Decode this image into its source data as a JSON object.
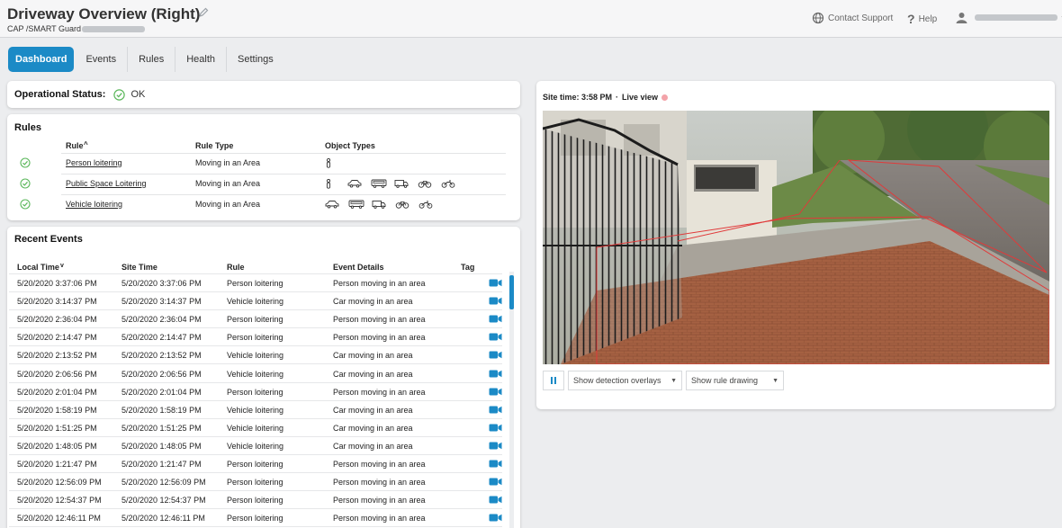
{
  "header": {
    "title": "Driveway Overview (Right)",
    "subtitle": "CAP /SMART Guard",
    "contact_support": "Contact Support",
    "help": "Help"
  },
  "tabs": [
    {
      "label": "Dashboard",
      "active": true
    },
    {
      "label": "Events",
      "active": false
    },
    {
      "label": "Rules",
      "active": false
    },
    {
      "label": "Health",
      "active": false
    },
    {
      "label": "Settings",
      "active": false
    }
  ],
  "operational_status": {
    "label": "Operational Status:",
    "value": "OK"
  },
  "rules": {
    "title": "Rules",
    "columns": {
      "rule": "Rule",
      "rule_type": "Rule Type",
      "object_types": "Object Types"
    },
    "rows": [
      {
        "name": "Person loitering",
        "type": "Moving in an Area",
        "objects": [
          "person-icon"
        ]
      },
      {
        "name": "Public Space Loitering",
        "type": "Moving in an Area",
        "objects": [
          "person-icon",
          "car-icon",
          "bus-icon",
          "truck-icon",
          "bicycle-icon",
          "motorcycle-icon"
        ]
      },
      {
        "name": "Vehicle loitering",
        "type": "Moving in an Area",
        "objects": [
          "car-icon",
          "bus-icon",
          "truck-icon",
          "bicycle-icon",
          "motorcycle-icon"
        ]
      }
    ]
  },
  "recent_events": {
    "title": "Recent Events",
    "columns": {
      "local_time": "Local Time",
      "site_time": "Site Time",
      "rule": "Rule",
      "event_details": "Event Details",
      "tag": "Tag"
    },
    "rows": [
      [
        "5/20/2020 3:37:06 PM",
        "5/20/2020 3:37:06 PM",
        "Person loitering",
        "Person moving in an area"
      ],
      [
        "5/20/2020 3:14:37 PM",
        "5/20/2020 3:14:37 PM",
        "Vehicle loitering",
        "Car moving in an area"
      ],
      [
        "5/20/2020 2:36:04 PM",
        "5/20/2020 2:36:04 PM",
        "Person loitering",
        "Person moving in an area"
      ],
      [
        "5/20/2020 2:14:47 PM",
        "5/20/2020 2:14:47 PM",
        "Person loitering",
        "Person moving in an area"
      ],
      [
        "5/20/2020 2:13:52 PM",
        "5/20/2020 2:13:52 PM",
        "Vehicle loitering",
        "Car moving in an area"
      ],
      [
        "5/20/2020 2:06:56 PM",
        "5/20/2020 2:06:56 PM",
        "Vehicle loitering",
        "Car moving in an area"
      ],
      [
        "5/20/2020 2:01:04 PM",
        "5/20/2020 2:01:04 PM",
        "Person loitering",
        "Person moving in an area"
      ],
      [
        "5/20/2020 1:58:19 PM",
        "5/20/2020 1:58:19 PM",
        "Vehicle loitering",
        "Car moving in an area"
      ],
      [
        "5/20/2020 1:51:25 PM",
        "5/20/2020 1:51:25 PM",
        "Vehicle loitering",
        "Car moving in an area"
      ],
      [
        "5/20/2020 1:48:05 PM",
        "5/20/2020 1:48:05 PM",
        "Vehicle loitering",
        "Car moving in an area"
      ],
      [
        "5/20/2020 1:21:47 PM",
        "5/20/2020 1:21:47 PM",
        "Person loitering",
        "Person moving in an area"
      ],
      [
        "5/20/2020 12:56:09 PM",
        "5/20/2020 12:56:09 PM",
        "Person loitering",
        "Person moving in an area"
      ],
      [
        "5/20/2020 12:54:37 PM",
        "5/20/2020 12:54:37 PM",
        "Person loitering",
        "Person moving in an area"
      ],
      [
        "5/20/2020 12:46:11 PM",
        "5/20/2020 12:46:11 PM",
        "Person loitering",
        "Person moving in an area"
      ]
    ]
  },
  "video": {
    "site_time_label": "Site time: 3:58 PM",
    "live_label": "Live view",
    "overlay_select": "Show detection overlays",
    "rule_select": "Show rule drawing"
  },
  "colors": {
    "accent": "#1b8ac6",
    "ok_green": "#5cb85c",
    "rule_outline": "#e03a3a",
    "live_dot": "#f3a3a9"
  }
}
